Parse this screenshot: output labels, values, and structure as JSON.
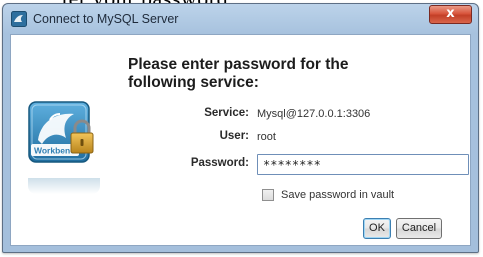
{
  "caption_fragment": "ter your password",
  "window": {
    "title": "Connect to MySQL Server",
    "close_label": "x"
  },
  "dialog": {
    "heading_line1": "Please enter password for the",
    "heading_line2": "following service:",
    "service_label": "Service:",
    "service_value": "Mysql@127.0.0.1:3306",
    "user_label": "User:",
    "user_value": "root",
    "password_label": "Password:",
    "password_value": "********",
    "save_password_label": "Save password in vault",
    "save_password_checked": false,
    "ok_label": "OK",
    "cancel_label": "Cancel"
  },
  "logo": {
    "text": "Workbench",
    "icon": "mysql-dolphin-lock-icon"
  },
  "colors": {
    "titlebar": "#a7c2de",
    "close_button": "#c33f27",
    "logo_blue": "#2f7fb3"
  }
}
